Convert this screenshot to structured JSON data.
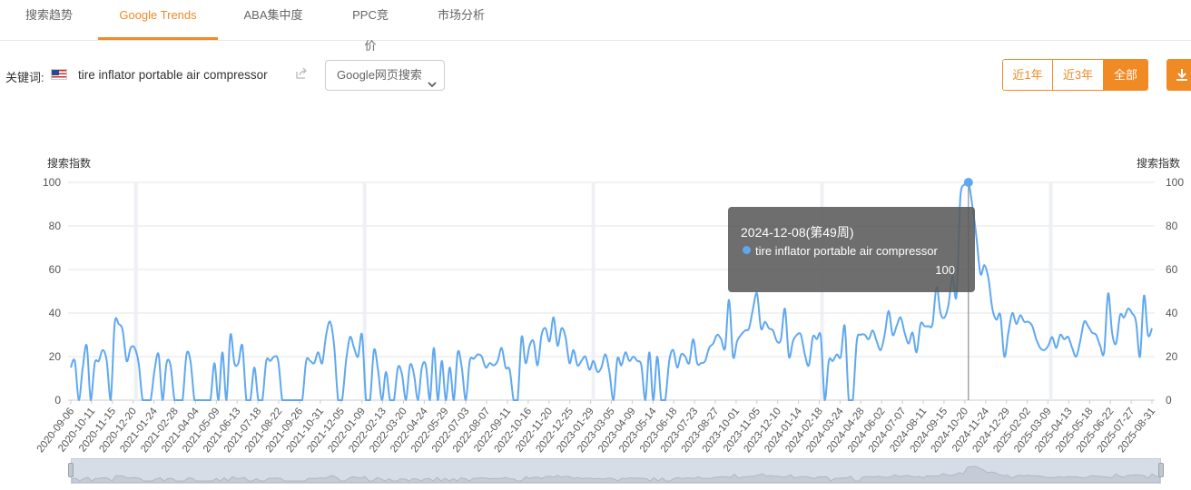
{
  "tabs": [
    {
      "label": "搜索趋势",
      "active": false
    },
    {
      "label": "Google Trends",
      "active": true
    },
    {
      "label": "ABA集中度",
      "active": false
    },
    {
      "label": "PPC竞价",
      "active": false
    },
    {
      "label": "市场分析",
      "active": false
    }
  ],
  "keyword": {
    "label": "关键词:",
    "flag": "us-flag-icon",
    "text": "tire inflator portable air compressor",
    "share_icon": "share-icon"
  },
  "search_type": {
    "selected": "Google网页搜索"
  },
  "range_buttons": [
    {
      "label": "近1年",
      "active": false
    },
    {
      "label": "近3年",
      "active": false
    },
    {
      "label": "全部",
      "active": true
    }
  ],
  "download_icon": "download-icon",
  "colors": {
    "accent": "#f08a24",
    "series": "#5fa8f0"
  },
  "tooltip": {
    "date": "2024-12-08(第49周)",
    "series": "tire inflator portable air compressor",
    "value": "100"
  },
  "chart_data": {
    "type": "line",
    "ylabel_left": "搜索指数",
    "ylabel_right": "搜索指数",
    "ylim": [
      0,
      100
    ],
    "yticks": [
      "0",
      "20",
      "40",
      "60",
      "80",
      "100"
    ],
    "xticks": [
      "2020-09-06",
      "2020-10-11",
      "2020-11-15",
      "2020-12-20",
      "2021-01-24",
      "2021-02-28",
      "2021-04-04",
      "2021-05-09",
      "2021-06-13",
      "2021-07-18",
      "2021-08-22",
      "2021-09-26",
      "2021-10-31",
      "2021-12-05",
      "2022-01-09",
      "2022-02-13",
      "2022-03-20",
      "2022-04-24",
      "2022-05-29",
      "2022-07-03",
      "2022-08-07",
      "2022-09-11",
      "2022-10-16",
      "2022-11-20",
      "2022-12-25",
      "2023-01-29",
      "2023-03-05",
      "2023-04-09",
      "2023-05-14",
      "2023-06-18",
      "2023-07-23",
      "2023-08-27",
      "2023-10-01",
      "2023-11-05",
      "2023-12-10",
      "2024-01-14",
      "2024-02-18",
      "2024-03-24",
      "2024-04-28",
      "2024-06-02",
      "2024-07-07",
      "2024-08-11",
      "2024-09-15",
      "2024-10-20",
      "2024-11-24",
      "2024-12-29",
      "2025-02-02",
      "2025-03-09",
      "2025-04-13",
      "2025-05-18",
      "2025-06-22",
      "2025-07-27",
      "2025-08-31"
    ],
    "grid": true,
    "legend": "none",
    "highlight": {
      "x": "2024-12-08",
      "value": 100
    },
    "series": [
      {
        "name": "tire inflator portable air compressor",
        "values": [
          15,
          18,
          0,
          15,
          25,
          0,
          17,
          18,
          23,
          18,
          0,
          35,
          35,
          32,
          18,
          24,
          24,
          17,
          0,
          0,
          0,
          14,
          21,
          0,
          17,
          16,
          0,
          0,
          0,
          21,
          18,
          0,
          0,
          0,
          0,
          0,
          17,
          0,
          22,
          0,
          30,
          17,
          17,
          25,
          0,
          0,
          15,
          0,
          0,
          18,
          18,
          20,
          18,
          0,
          0,
          0,
          0,
          0,
          0,
          18,
          18,
          17,
          22,
          17,
          30,
          36,
          25,
          0,
          0,
          18,
          29,
          24,
          20,
          30,
          0,
          0,
          23,
          14,
          0,
          13,
          0,
          0,
          15,
          12,
          0,
          16,
          12,
          0,
          15,
          16,
          0,
          24,
          0,
          18,
          0,
          15,
          0,
          22,
          15,
          0,
          18,
          19,
          21,
          20,
          15,
          17,
          16,
          18,
          24,
          15,
          14,
          0,
          0,
          29,
          17,
          25,
          27,
          16,
          30,
          33,
          27,
          38,
          25,
          33,
          29,
          17,
          23,
          16,
          18,
          20,
          14,
          18,
          13,
          15,
          21,
          13,
          0,
          19,
          16,
          22,
          18,
          20,
          18,
          16,
          0,
          22,
          0,
          20,
          0,
          0,
          18,
          23,
          15,
          21,
          20,
          17,
          28,
          17,
          17,
          18,
          24,
          26,
          30,
          28,
          24,
          46,
          20,
          27,
          30,
          32,
          33,
          42,
          49,
          33,
          36,
          33,
          32,
          27,
          28,
          42,
          20,
          27,
          30,
          30,
          21,
          16,
          29,
          28,
          29,
          0,
          18,
          18,
          21,
          20,
          34,
          0,
          0,
          27,
          30,
          30,
          28,
          32,
          27,
          23,
          30,
          41,
          30,
          34,
          38,
          31,
          26,
          31,
          22,
          35,
          34,
          34,
          35,
          52,
          40,
          38,
          44,
          57,
          48,
          94,
          99,
          100,
          89,
          75,
          58,
          62,
          56,
          42,
          37,
          39,
          20,
          31,
          40,
          35,
          39,
          36,
          36,
          34,
          28,
          24,
          23,
          25,
          29,
          24,
          30,
          28,
          29,
          24,
          20,
          27,
          36,
          34,
          31,
          30,
          25,
          22,
          49,
          31,
          26,
          39,
          38,
          42,
          40,
          36,
          20,
          48,
          30,
          33
        ]
      }
    ]
  }
}
